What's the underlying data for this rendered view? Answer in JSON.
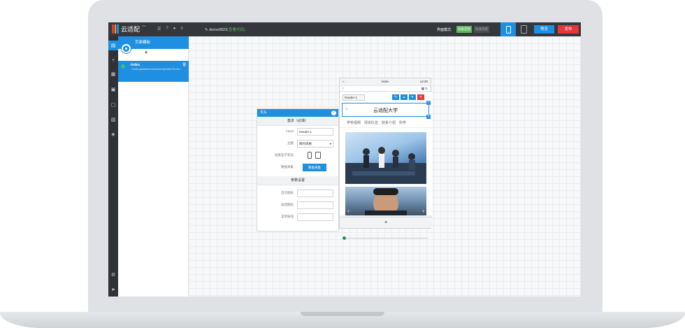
{
  "app": {
    "logo_text": "云适配",
    "logo_beta": "beta",
    "project_name": "demo0823",
    "project_note": "(查看代码)",
    "mode_label": "界面模式:",
    "mode_on": "高级定制",
    "mode_off": "快速适配",
    "preview_label": "预览",
    "publish_label": "发布"
  },
  "pages_panel": {
    "header": "页面模板",
    "item_name": "index",
    "item_url": "~/index.jsp#iframeview/index/js/dat/1/93.htm"
  },
  "props": {
    "title": "页头",
    "section_basic": "基本（必填）",
    "class_label": "Class",
    "class_value": "header-1",
    "theme_label": "主题",
    "theme_value": "简约风格",
    "device_label": "设备显示状态",
    "collect_label": "数据采集",
    "collect_button": "数据采集",
    "section_params": "参数设置",
    "home_link_label": "首页图标",
    "back_label": "返回图标",
    "menu_label": "菜单按钮"
  },
  "phone": {
    "status_title": "index",
    "status_time": "14:30",
    "url": "/",
    "component_tag": "header-1",
    "header_title": "云适配大学",
    "nav": [
      "学校视频",
      "师资队伍",
      "院系介绍",
      "科学"
    ],
    "footer_icon": "≡"
  },
  "colors": {
    "accent": "#1e8fe1",
    "danger": "#e5383b",
    "success": "#5cb85c",
    "topbar": "#34373c"
  }
}
